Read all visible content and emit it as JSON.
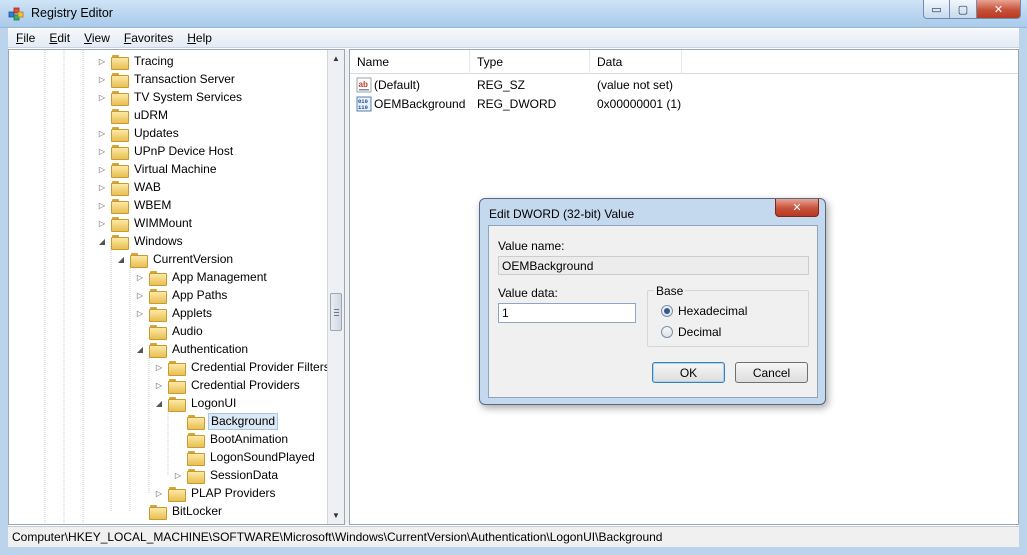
{
  "window": {
    "title": "Registry Editor",
    "min_glyph": "▭",
    "max_glyph": "▢",
    "close_glyph": "✕"
  },
  "menu": [
    {
      "label": "File",
      "mnemonic": "F",
      "rest": "ile"
    },
    {
      "label": "Edit",
      "mnemonic": "E",
      "rest": "dit"
    },
    {
      "label": "View",
      "mnemonic": "V",
      "rest": "iew"
    },
    {
      "label": "Favorites",
      "mnemonic": "F",
      "rest": "avorites"
    },
    {
      "label": "Help",
      "mnemonic": "H",
      "rest": "elp"
    }
  ],
  "tree": [
    {
      "label": "Tracing",
      "level": 0,
      "expander": "collapsed"
    },
    {
      "label": "Transaction Server",
      "level": 0,
      "expander": "collapsed"
    },
    {
      "label": "TV System Services",
      "level": 0,
      "expander": "collapsed"
    },
    {
      "label": "uDRM",
      "level": 0,
      "expander": "none"
    },
    {
      "label": "Updates",
      "level": 0,
      "expander": "collapsed"
    },
    {
      "label": "UPnP Device Host",
      "level": 0,
      "expander": "collapsed"
    },
    {
      "label": "Virtual Machine",
      "level": 0,
      "expander": "collapsed"
    },
    {
      "label": "WAB",
      "level": 0,
      "expander": "collapsed"
    },
    {
      "label": "WBEM",
      "level": 0,
      "expander": "collapsed"
    },
    {
      "label": "WIMMount",
      "level": 0,
      "expander": "collapsed"
    },
    {
      "label": "Windows",
      "level": 0,
      "expander": "expanded"
    },
    {
      "label": "CurrentVersion",
      "level": 1,
      "expander": "expanded"
    },
    {
      "label": "App Management",
      "level": 2,
      "expander": "collapsed"
    },
    {
      "label": "App Paths",
      "level": 2,
      "expander": "collapsed"
    },
    {
      "label": "Applets",
      "level": 2,
      "expander": "collapsed"
    },
    {
      "label": "Audio",
      "level": 2,
      "expander": "none"
    },
    {
      "label": "Authentication",
      "level": 2,
      "expander": "expanded"
    },
    {
      "label": "Credential Provider Filters",
      "level": 3,
      "expander": "collapsed"
    },
    {
      "label": "Credential Providers",
      "level": 3,
      "expander": "collapsed"
    },
    {
      "label": "LogonUI",
      "level": 3,
      "expander": "expanded"
    },
    {
      "label": "Background",
      "level": 4,
      "expander": "none",
      "selected": true
    },
    {
      "label": "BootAnimation",
      "level": 4,
      "expander": "none"
    },
    {
      "label": "LogonSoundPlayed",
      "level": 4,
      "expander": "none"
    },
    {
      "label": "SessionData",
      "level": 4,
      "expander": "collapsed"
    },
    {
      "label": "PLAP Providers",
      "level": 3,
      "expander": "collapsed"
    },
    {
      "label": "BitLocker",
      "level": 2,
      "expander": "none"
    }
  ],
  "list": {
    "columns": [
      "Name",
      "Type",
      "Data"
    ],
    "rows": [
      {
        "name": "(Default)",
        "type": "REG_SZ",
        "data": "(value not set)",
        "icon": "string-value-icon"
      },
      {
        "name": "OEMBackground",
        "type": "REG_DWORD",
        "data": "0x00000001 (1)",
        "icon": "binary-value-icon"
      }
    ]
  },
  "status": {
    "path": "Computer\\HKEY_LOCAL_MACHINE\\SOFTWARE\\Microsoft\\Windows\\CurrentVersion\\Authentication\\LogonUI\\Background"
  },
  "dialog": {
    "title": "Edit DWORD (32-bit) Value",
    "close_glyph": "✕",
    "value_name_label": "Value name:",
    "value_name": "OEMBackground",
    "value_data_label": "Value data:",
    "value_data": "1",
    "base_label": "Base",
    "radio_hex": "Hexadecimal",
    "radio_dec": "Decimal",
    "selected_base": "hex",
    "ok_label": "OK",
    "cancel_label": "Cancel"
  },
  "colors": {
    "titlebar": "#b9d5ef",
    "selection": "#dbe8f5",
    "close_button": "#c7513a"
  }
}
